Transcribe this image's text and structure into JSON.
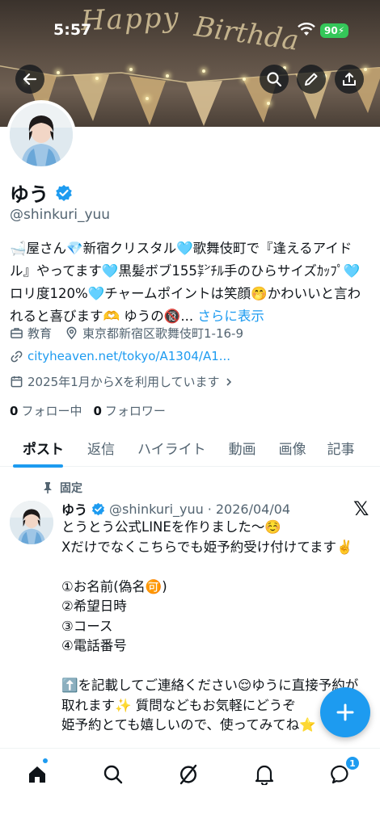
{
  "status_bar": {
    "time": "5:57",
    "battery": "90"
  },
  "header": {
    "back_icon": "arrow-left-icon",
    "search_icon": "search-icon",
    "edit_icon": "pencil-icon",
    "share_icon": "share-icon"
  },
  "profile": {
    "display_name": "ゆう",
    "handle": "@shinkuri_yuu",
    "bio": "🛁屋さん💎新宿クリスタル🩵歌舞伎町で『逢えるアイドル』やってます🩵黒髪ボブ155㌢ﾁﾙ手のひらサイズｶｯﾌﾟ🩵ロリ度120%🩵チャームポイントは笑顔🤭かわいいと言われると喜びます🫶 ゆうの🔞...",
    "bio_more": "さらに表示",
    "category": "教育",
    "location": "東京都新宿区歌舞伎町1-16-9",
    "link": "cityheaven.net/tokyo/A1304/A1...",
    "joined": "2025年1月からXを利用しています",
    "following_count": "0",
    "following_label": "フォロー中",
    "followers_count": "0",
    "followers_label": "フォロワー"
  },
  "tabs": [
    {
      "label": "ポスト",
      "active": true
    },
    {
      "label": "返信"
    },
    {
      "label": "ハイライト"
    },
    {
      "label": "動画"
    },
    {
      "label": "画像"
    },
    {
      "label": "記事"
    }
  ],
  "pinned_tweet": {
    "pinned_label": "固定",
    "name": "ゆう",
    "handle": "@shinkuri_yuu",
    "separator": "·",
    "date": "2026/04/04",
    "text": "とうとう公式LINEを作りました〜☺️\nXだけでなくこちらでも姫予約受け付けてます✌️\n\n①お名前(偽名🉑)\n②希望日時\n③コース\n④電話番号\n\n⬆️を記載してご連絡ください😌ゆうに直接予約が取れます✨ 質問などもお気軽にどうぞ\n姫予約とても嬉しいので、使ってみてね⭐"
  },
  "bottom_nav": {
    "items": [
      "home-icon",
      "search-icon",
      "grok-icon",
      "bell-icon",
      "messages-icon"
    ],
    "messages_badge": "1"
  },
  "colors": {
    "accent": "#1d9bf0",
    "text": "#0f1419",
    "muted": "#536471"
  }
}
